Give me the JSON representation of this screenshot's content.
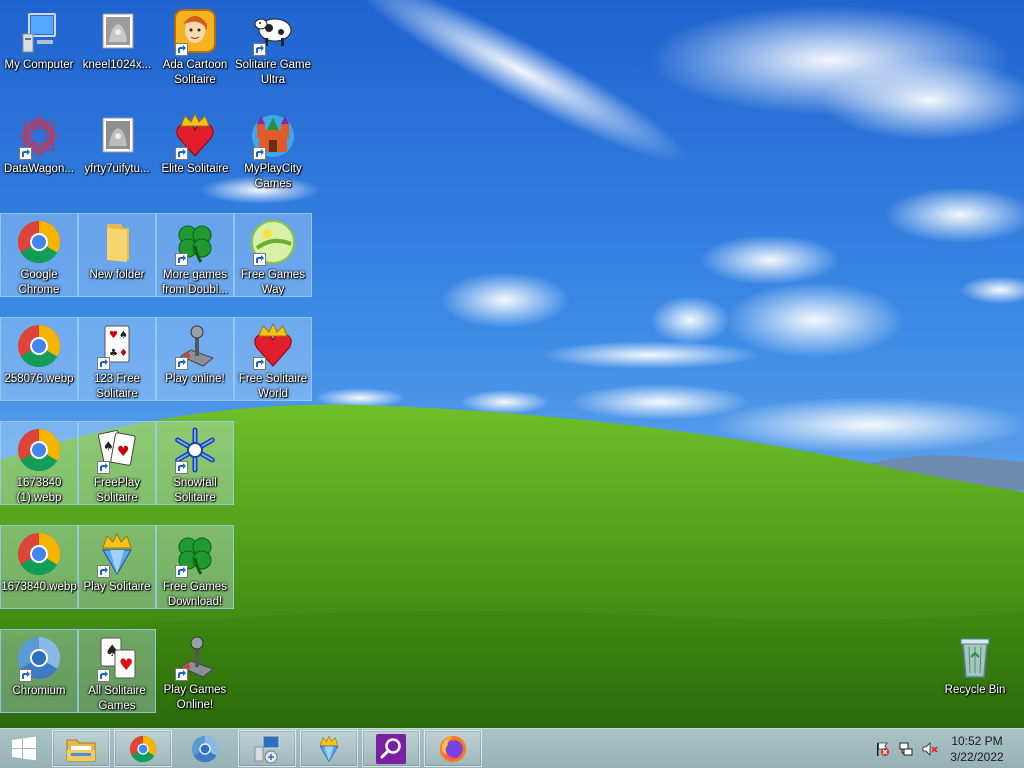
{
  "desktop": {
    "icons": [
      {
        "label": "My Computer",
        "icon": "computer-icon",
        "shortcut": false,
        "selected": false
      },
      {
        "label": "kneel1024x...",
        "icon": "image-file-icon",
        "shortcut": false,
        "selected": false
      },
      {
        "label": "Ada Cartoon Solitaire",
        "icon": "ada-cartoon-icon",
        "shortcut": true,
        "selected": false
      },
      {
        "label": "Solitaire Game Ultra",
        "icon": "cow-icon",
        "shortcut": true,
        "selected": false
      },
      {
        "label": "DataWagon...",
        "icon": "datawagon-icon",
        "shortcut": true,
        "selected": false
      },
      {
        "label": "yfrty7uifytu...",
        "icon": "image-file-icon",
        "shortcut": false,
        "selected": false
      },
      {
        "label": "Elite Solitaire",
        "icon": "crown-heart-icon",
        "shortcut": true,
        "selected": false
      },
      {
        "label": "MyPlayCity Games",
        "icon": "castle-icon",
        "shortcut": true,
        "selected": false
      },
      {
        "label": "Google Chrome",
        "icon": "chrome-icon",
        "shortcut": false,
        "selected": true
      },
      {
        "label": "New folder",
        "icon": "folder-icon",
        "shortcut": false,
        "selected": true
      },
      {
        "label": "More games from Doubl...",
        "icon": "clover-icon",
        "shortcut": true,
        "selected": true
      },
      {
        "label": "Free Games Way",
        "icon": "free-games-way-icon",
        "shortcut": true,
        "selected": true
      },
      {
        "label": "258076.webp",
        "icon": "chrome-icon",
        "shortcut": false,
        "selected": true
      },
      {
        "label": "123 Free Solitaire",
        "icon": "cards-icon",
        "shortcut": true,
        "selected": true
      },
      {
        "label": "Play online!",
        "icon": "joystick-icon",
        "shortcut": true,
        "selected": true
      },
      {
        "label": "Free Solitaire World",
        "icon": "crown-heart-icon",
        "shortcut": true,
        "selected": true
      },
      {
        "label": "1673840 (1).webp",
        "icon": "chrome-icon",
        "shortcut": false,
        "selected": true
      },
      {
        "label": "FreePlay Solitaire",
        "icon": "playing-cards-icon",
        "shortcut": true,
        "selected": true
      },
      {
        "label": "Snowfall Solitaire",
        "icon": "snowflake-icon",
        "shortcut": true,
        "selected": true
      },
      {
        "label": "1673840.webp",
        "icon": "chrome-icon",
        "shortcut": false,
        "selected": true
      },
      {
        "label": "Play Solitaire",
        "icon": "crown-diamond-icon",
        "shortcut": true,
        "selected": true
      },
      {
        "label": "Free Games Download!",
        "icon": "clover-icon",
        "shortcut": true,
        "selected": true
      },
      {
        "label": "Chromium",
        "icon": "chromium-icon",
        "shortcut": true,
        "selected": true
      },
      {
        "label": "All Solitaire Games",
        "icon": "ace-cards-icon",
        "shortcut": true,
        "selected": true
      },
      {
        "label": "Play Games Online!",
        "icon": "joystick-icon",
        "shortcut": true,
        "selected": false
      },
      {
        "label": "Recycle Bin",
        "icon": "recycle-bin-icon",
        "shortcut": false,
        "selected": false
      }
    ]
  },
  "taskbar": {
    "start_icon": "windows-logo-icon",
    "apps": [
      {
        "name": "File Explorer",
        "icon": "file-explorer-icon"
      },
      {
        "name": "Google Chrome",
        "icon": "chrome-icon"
      },
      {
        "name": "Chromium",
        "icon": "chromium-icon"
      },
      {
        "name": "Network app",
        "icon": "network-computer-icon"
      },
      {
        "name": "Play Solitaire",
        "icon": "crown-diamond-icon"
      },
      {
        "name": "Search app",
        "icon": "magnifier-icon"
      },
      {
        "name": "Firefox",
        "icon": "firefox-icon"
      }
    ],
    "tray": [
      {
        "icon": "action-center-flag-icon"
      },
      {
        "icon": "network-icon"
      },
      {
        "icon": "volume-muted-icon"
      }
    ],
    "clock": {
      "time": "10:52 PM",
      "date": "3/22/2022"
    }
  },
  "colors": {
    "taskbar": "#a0bcbe",
    "selection_fill": "#cde8ff",
    "sky": "#2f78d9",
    "grass": "#4f9a1c"
  }
}
